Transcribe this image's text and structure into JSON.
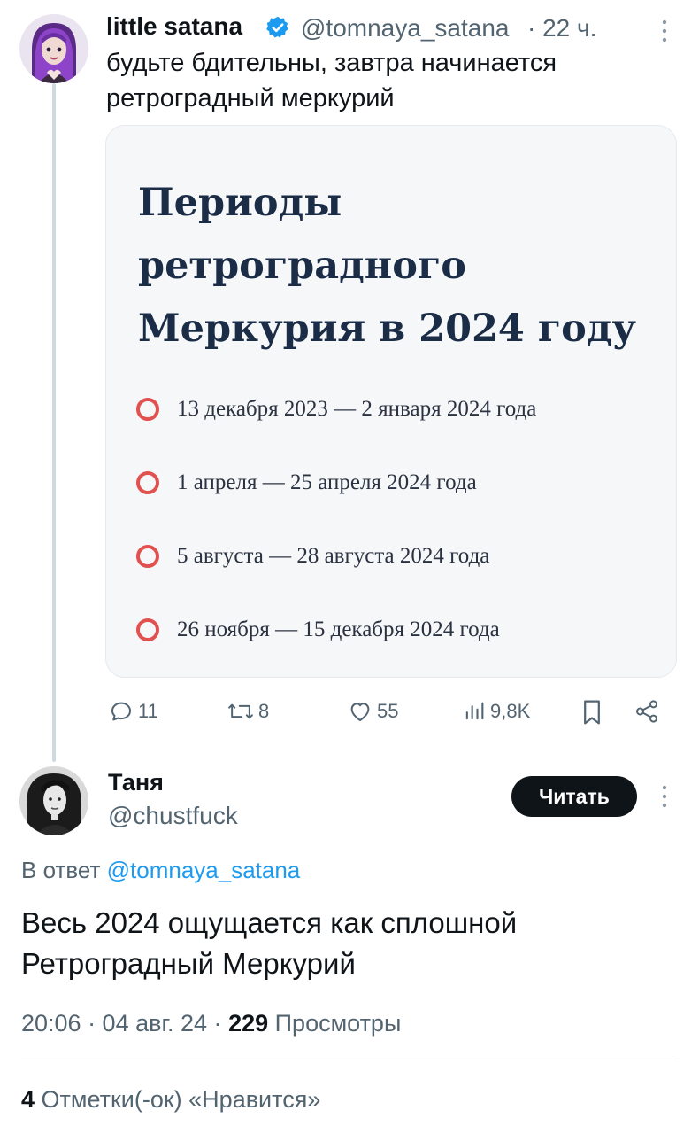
{
  "tweet": {
    "author_name": "little satana",
    "author_handle": "@tomnaya_satana",
    "time": "· 22 ч.",
    "text_line1": "будьте бдительны, завтра начинается",
    "text_line2": "ретроградный меркурий",
    "card": {
      "title_line1": "Периоды",
      "title_line2": "ретроградного",
      "title_line3": "Меркурия в 2024 году",
      "periods": [
        "13 декабря 2023 — 2 января 2024 года",
        "1 апреля — 25 апреля 2024 года",
        "5 августа — 28 августа 2024 года",
        "26 ноября — 15 декабря 2024 года"
      ],
      "accent_color": "#e0514f"
    },
    "actions": {
      "replies": "11",
      "retweets": "8",
      "likes": "55",
      "views": "9,8K"
    }
  },
  "reply": {
    "author_name": "Таня",
    "author_handle": "@chustfuck",
    "follow_label": "Читать",
    "reply_to_prefix": "В ответ",
    "reply_to_handle": "@tomnaya_satana",
    "text_line1": "Весь 2024 ощущается как сплошной",
    "text_line2": "Ретроградный Меркурий",
    "timestamp": "20:06 · 04 авг. 24 ·",
    "views_count": "229",
    "views_label": "Просмотры",
    "likes_count": "4",
    "likes_label": "Отметки(-ок) «Нравится»"
  },
  "colors": {
    "link": "#1d9bf0",
    "verified": "#1d9bf0",
    "muted": "#536471"
  }
}
